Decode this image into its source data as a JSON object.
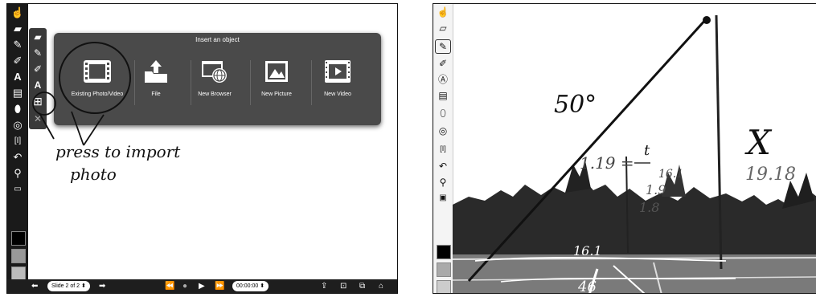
{
  "left": {
    "popup": {
      "title": "Insert an object",
      "items": [
        {
          "label": "Existing Photo/Video",
          "icon": "film-icon"
        },
        {
          "label": "File",
          "icon": "upload-folder-icon"
        },
        {
          "label": "New Browser",
          "icon": "browser-globe-icon"
        },
        {
          "label": "New Picture",
          "icon": "picture-icon"
        },
        {
          "label": "New Video",
          "icon": "video-icon"
        }
      ]
    },
    "annotation_line1": "press to import",
    "annotation_line2": "photo",
    "bottom": {
      "slide_select": "Slide 2 of 2",
      "time": "00:00:00"
    }
  },
  "right": {
    "annotations": {
      "angle": "50°",
      "eq1": "1.19 =",
      "frac_top": "t",
      "frac_bottom": "16.1",
      "eq2_line1": "1.9",
      "eq2_line2": "1.8",
      "x": "X",
      "ratio": "19.18",
      "base": "16.1",
      "bottom": "46"
    }
  },
  "colors": {
    "toolbar": "#1a1a1a",
    "popup": "#4a4a4a",
    "accent": "#ffffff"
  }
}
